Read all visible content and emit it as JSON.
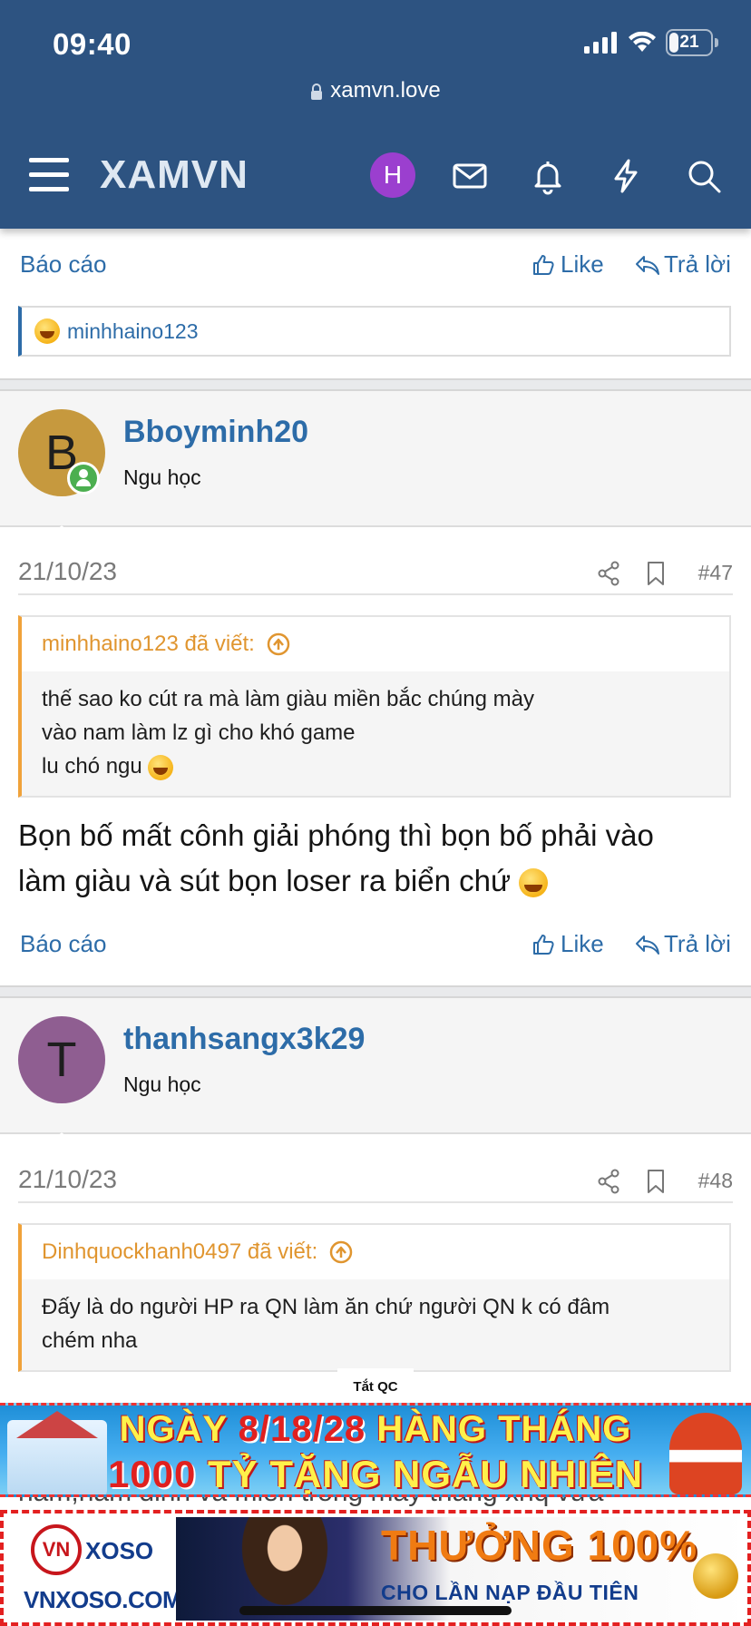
{
  "status_bar": {
    "time": "09:40",
    "battery": "21"
  },
  "browser": {
    "url": "xamvn.love"
  },
  "navbar": {
    "logo": "XAMVN",
    "avatar_letter": "H",
    "colors": {
      "bar": "#2d5381",
      "avatar": "#9b3fcf"
    }
  },
  "actions": {
    "report": "Báo cáo",
    "like": "Like",
    "reply": "Trả lời"
  },
  "prev_post": {
    "reaction_user": "minhhaino123"
  },
  "posts": [
    {
      "avatar_letter": "B",
      "avatar_color": "#c6993e",
      "username": "Bboyminh20",
      "user_title": "Ngu học",
      "date": "21/10/23",
      "number": "#47",
      "quote_author": "minhhaino123 đã viết:",
      "quote_lines": [
        "thế sao ko cút ra mà làm giàu miền bắc chúng mày",
        "vào nam làm lz gì cho khó game",
        "lu chó ngu"
      ],
      "text_lines": [
        "Bọn bố mất cônh giải phóng thì bọn bố phải vào",
        "làm giàu và sút bọn loser ra biển chứ"
      ]
    },
    {
      "avatar_letter": "T",
      "avatar_color": "#8f5e91",
      "username": "thanhsangx3k29",
      "user_title": "Ngu học",
      "date": "21/10/23",
      "number": "#48",
      "quote_author": "Dinhquockhanh0497 đã viết:",
      "quote_lines": [
        "Đấy là do người HP ra QN làm ăn chứ người QN k có đâm",
        "chém nha"
      ],
      "peek_text": "nam,nam đinh và miền trong mấy tháng xnq vừa"
    }
  ],
  "ads": {
    "label": "Tắt QC",
    "banner1": {
      "line1_a": "NGÀY ",
      "line1_hl": "8/18/28",
      "line1_b": " HÀNG THÁNG",
      "line2_hl": "1000",
      "line2_b": " TỶ TẶNG NGẪU NHIÊN"
    },
    "banner2": {
      "brand_circle": "VN",
      "brand_word": "XOSO",
      "brand_domain": "VNXOSO.COM",
      "bonus": "THƯỞNG 100%",
      "sub": "CHO LẦN NẠP ĐẦU TIÊN"
    }
  }
}
